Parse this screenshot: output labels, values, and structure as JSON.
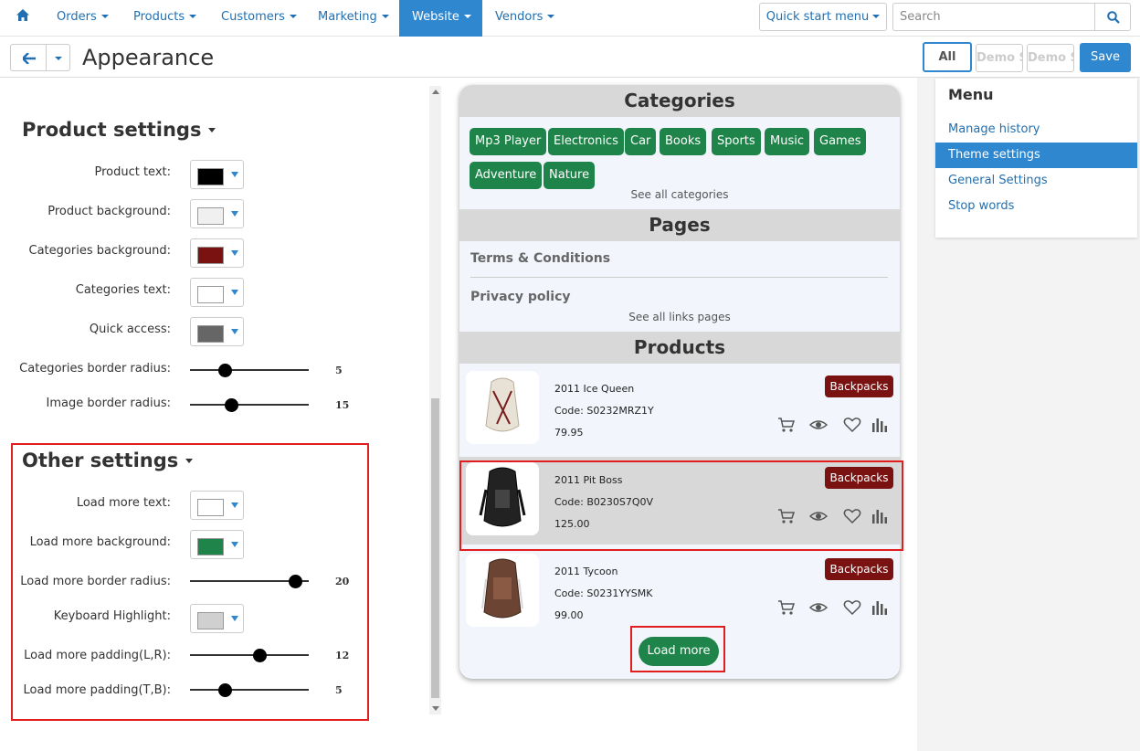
{
  "topnav": {
    "items": [
      {
        "label": "Orders"
      },
      {
        "label": "Products"
      },
      {
        "label": "Customers"
      },
      {
        "label": "Marketing"
      },
      {
        "label": "Website",
        "active": true
      },
      {
        "label": "Vendors"
      }
    ],
    "quick_start": "Quick start menu",
    "search_placeholder": "Search"
  },
  "header": {
    "title": "Appearance",
    "all_label": "All",
    "store_labels": [
      "Demo Store",
      "Demo Store"
    ],
    "save_label": "Save"
  },
  "product_settings": {
    "title": "Product settings",
    "colors": [
      {
        "label": "Product text:",
        "color": "#000000"
      },
      {
        "label": "Product background:",
        "color": "#f0f0f0"
      },
      {
        "label": "Categories background:",
        "color": "#7b1212"
      },
      {
        "label": "Categories text:",
        "color": "#ffffff"
      },
      {
        "label": "Quick access:",
        "color": "#666666"
      }
    ],
    "sliders": [
      {
        "label": "Categories border radius:",
        "value": "5",
        "fraction": 0.27
      },
      {
        "label": "Image border radius:",
        "value": "15",
        "fraction": 0.33
      }
    ]
  },
  "other_settings": {
    "title": "Other settings",
    "load_more_text": {
      "label": "Load more text:",
      "color": "#ffffff"
    },
    "load_more_background": {
      "label": "Load more background:",
      "color": "#1e8449"
    },
    "load_more_radius": {
      "label": "Load more border radius:",
      "value": "20",
      "fraction": 0.94
    },
    "keyboard_highlight": {
      "label": "Keyboard Highlight:",
      "color": "#d0d0d0"
    },
    "padding_lr": {
      "label": "Load more padding(L,R):",
      "value": "12",
      "fraction": 0.6
    },
    "padding_tb": {
      "label": "Load more padding(T,B):",
      "value": "5",
      "fraction": 0.27
    }
  },
  "preview": {
    "categories_title": "Categories",
    "categories": [
      "Mp3 Player",
      "Electronics",
      "Car",
      "Books",
      "Sports",
      "Music",
      "Games",
      "Adventure",
      "Nature"
    ],
    "see_all_categories": "See all categories",
    "pages_title": "Pages",
    "pages": [
      "Terms & Conditions",
      "Privacy policy"
    ],
    "see_all_pages": "See all links pages",
    "products_title": "Products",
    "products": [
      {
        "name": "2011 Ice Queen",
        "code": "Code: S0232MRZ1Y",
        "price": "79.95",
        "badge": "Backpacks",
        "pack_color": "#e8e2d6"
      },
      {
        "name": "2011 Pit Boss",
        "code": "Code: B0230S7Q0V",
        "price": "125.00",
        "badge": "Backpacks",
        "pack_color": "#222222"
      },
      {
        "name": "2011 Tycoon",
        "code": "Code: S0231YYSMK",
        "price": "99.00",
        "badge": "Backpacks",
        "pack_color": "#6b4433"
      }
    ],
    "load_more": "Load more"
  },
  "menu": {
    "title": "Menu",
    "items": [
      {
        "label": "Manage history"
      },
      {
        "label": "Theme settings",
        "active": true
      },
      {
        "label": "General Settings"
      },
      {
        "label": "Stop words"
      }
    ]
  }
}
